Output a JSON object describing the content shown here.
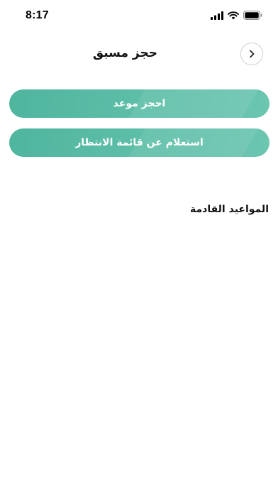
{
  "status_bar": {
    "time": "8:17",
    "icons": [
      "signal-icon",
      "wifi-icon",
      "battery-icon"
    ]
  },
  "header": {
    "title": "حجز مسبق",
    "back_icon": "chevron-right-icon"
  },
  "actions": {
    "book_label": "احجز موعد",
    "waitlist_label": "استعلام عن قائمة الانتظار"
  },
  "upcoming": {
    "title": "المواعيد القادمة",
    "items": []
  },
  "colors": {
    "accent": "#5bbba5",
    "background": "#ffffff",
    "text": "#111111"
  }
}
